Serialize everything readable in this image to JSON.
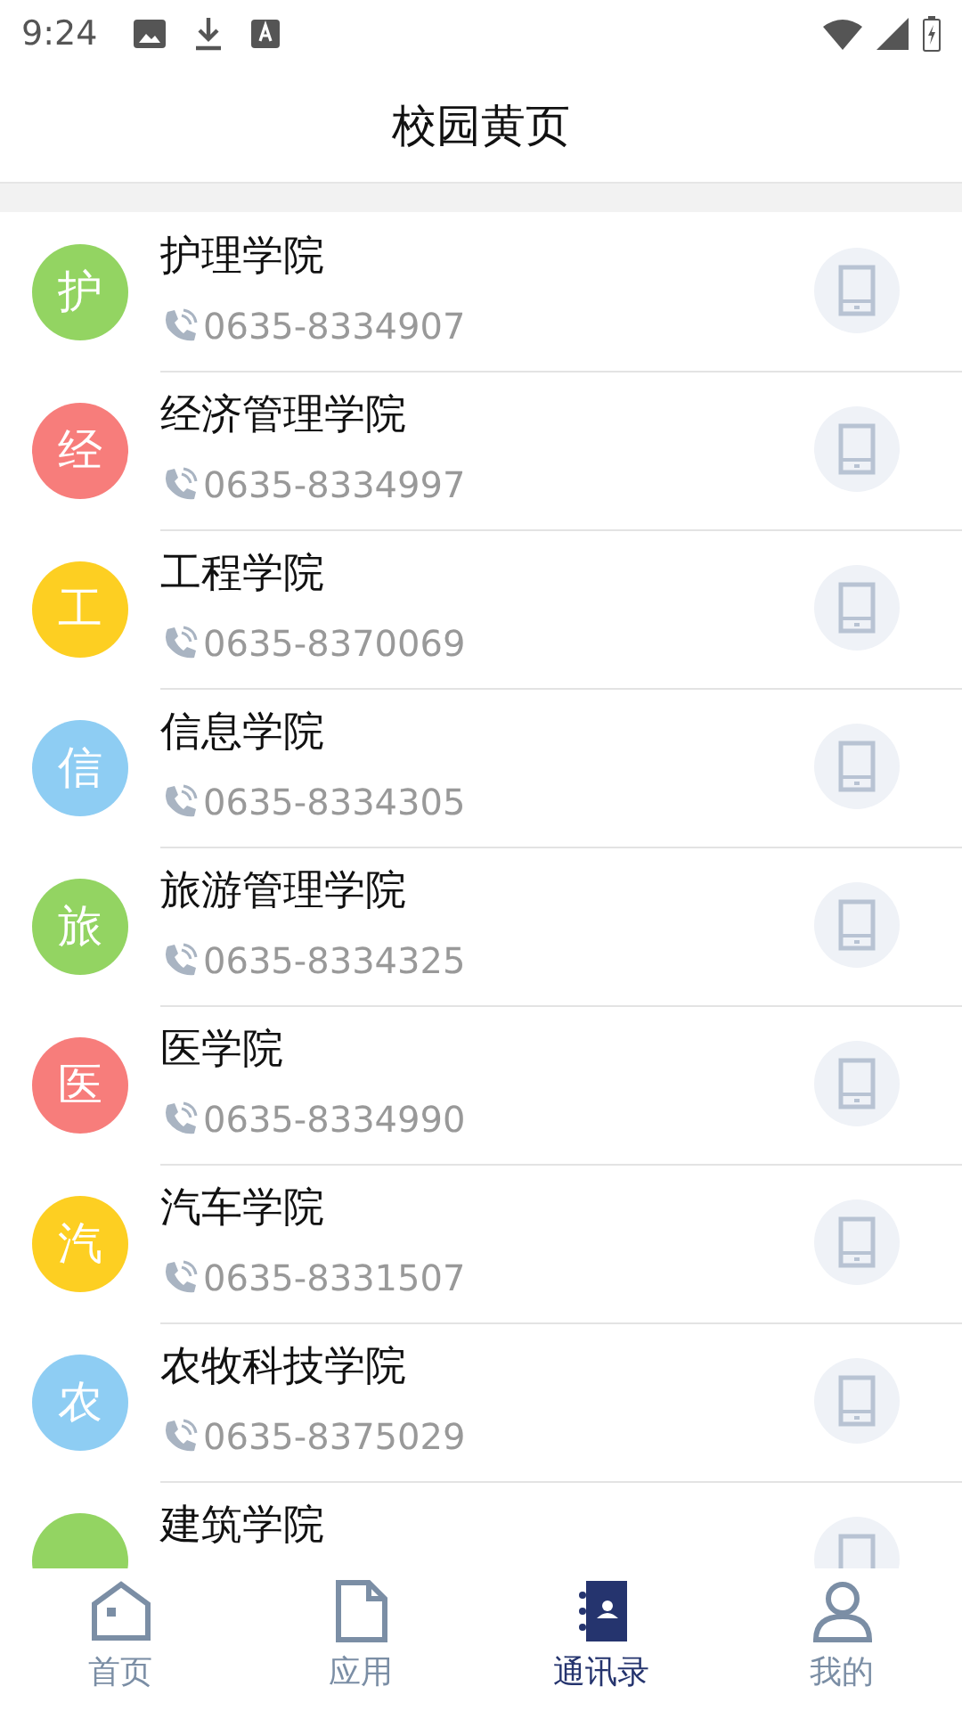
{
  "status_bar": {
    "time": "9:24"
  },
  "header": {
    "title": "校园黄页"
  },
  "contacts": [
    {
      "avatar": "护",
      "color": "#93d462",
      "name": "护理学院",
      "phone": "0635-8334907"
    },
    {
      "avatar": "经",
      "color": "#f77d7b",
      "name": "经济管理学院",
      "phone": "0635-8334997"
    },
    {
      "avatar": "工",
      "color": "#fdcf22",
      "name": "工程学院",
      "phone": "0635-8370069"
    },
    {
      "avatar": "信",
      "color": "#8ecdf3",
      "name": "信息学院",
      "phone": "0635-8334305"
    },
    {
      "avatar": "旅",
      "color": "#93d462",
      "name": "旅游管理学院",
      "phone": "0635-8334325"
    },
    {
      "avatar": "医",
      "color": "#f77d7b",
      "name": "医学院",
      "phone": "0635-8334990"
    },
    {
      "avatar": "汽",
      "color": "#fdcf22",
      "name": "汽车学院",
      "phone": "0635-8331507"
    },
    {
      "avatar": "农",
      "color": "#8ecdf3",
      "name": "农牧科技学院",
      "phone": "0635-8375029"
    },
    {
      "color": "#93d462",
      "name": "建筑学院"
    }
  ],
  "tabs": [
    {
      "kind": "home",
      "label": "首页",
      "selected": false
    },
    {
      "kind": "apps",
      "label": "应用",
      "selected": false
    },
    {
      "kind": "contacts",
      "label": "通讯录",
      "selected": true
    },
    {
      "kind": "me",
      "label": "我的",
      "selected": false
    }
  ]
}
